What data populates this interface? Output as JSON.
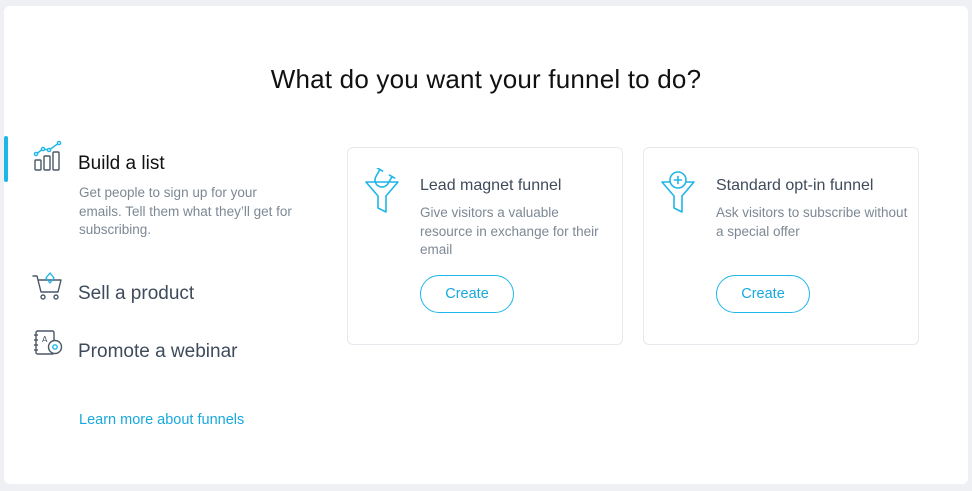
{
  "page": {
    "title": "What do you want your funnel to do?"
  },
  "menu": {
    "items": [
      {
        "label": "Build a list",
        "description": "Get people to sign up for your emails. Tell them what they’ll get for subscribing.",
        "icon": "bar-chart-growth-icon",
        "active": true
      },
      {
        "label": "Sell a product",
        "icon": "shopping-cart-icon",
        "active": false
      },
      {
        "label": "Promote a webinar",
        "icon": "webinar-notebook-icon",
        "active": false
      }
    ],
    "learn_more": "Learn more about funnels"
  },
  "cards": [
    {
      "title": "Lead magnet funnel",
      "description": "Give visitors a valuable resource in exchange for their email",
      "button": "Create",
      "icon": "magnet-funnel-icon"
    },
    {
      "title": "Standard opt-in funnel",
      "description": "Ask visitors to subscribe without a special offer",
      "button": "Create",
      "icon": "plus-funnel-icon"
    }
  ],
  "colors": {
    "accent": "#1fb6e8",
    "link": "#18a8dc",
    "text_dark": "#111111",
    "text_muted": "#7d8894",
    "background": "#eef0f3"
  }
}
